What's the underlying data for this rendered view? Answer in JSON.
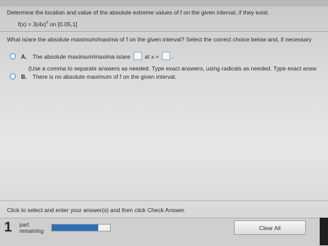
{
  "question": {
    "text": "Determine the location and value of the absolute extreme values of f on the given interval, if they exist.",
    "function_prefix": "f(x) = 3(4x)",
    "function_exponent": "x",
    "function_suffix": " on [0.05,1]"
  },
  "prompt": "What is/are the absolute maximum/maxima of f on the given interval? Select the correct choice below and, if necessary",
  "options": {
    "a_letter": "A.",
    "a_text_1": "The absolute maximum/maxima is/are",
    "a_text_2": "at x =",
    "a_end": ".",
    "a_sub": "(Use a comma to separate answers as needed. Type exact answers, using radicals as needed. Type exact answ",
    "b_letter": "B.",
    "b_text": "There is no absolute maximum of f on the given interval."
  },
  "instruction": "Click to select and enter your answer(s) and then click Check Answer.",
  "footer": {
    "count": "1",
    "part_label_1": "part",
    "part_label_2": "remaining",
    "progress_fraction": 0.8,
    "clear_label": "Clear All"
  },
  "colors": {
    "accent": "#2f6fb5",
    "radio": "#3a8fcf"
  }
}
